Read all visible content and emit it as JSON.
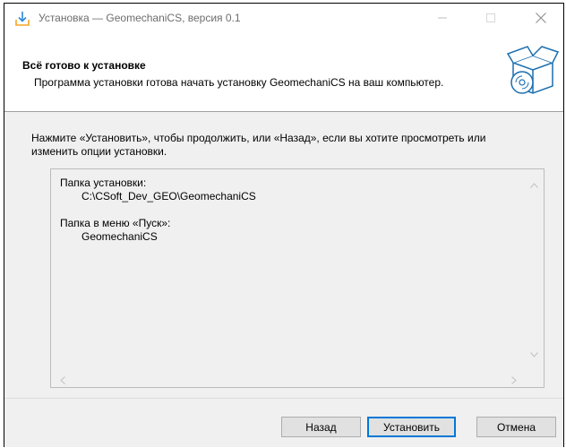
{
  "window": {
    "title": "Установка — GeomechaniCS, версия 0.1"
  },
  "header": {
    "title": "Всё готово к установке",
    "subtitle": "Программа установки готова начать установку GeomechaniCS на ваш компьютер."
  },
  "instruction": "Нажмите «Установить», чтобы продолжить, или «Назад», если вы хотите просмотреть или изменить опции установки.",
  "memo": {
    "install_folder_label": "Папка установки:",
    "install_folder_value": "C:\\CSoft_Dev_GEO\\GeomechaniCS",
    "start_menu_label": "Папка в меню «Пуск»:",
    "start_menu_value": "GeomechaniCS"
  },
  "buttons": {
    "back": "Назад",
    "install": "Установить",
    "cancel": "Отмена"
  },
  "icons": {
    "title": "download-arrow-icon",
    "header": "software-box-cd-icon",
    "minimize": "minimize-icon",
    "maximize": "maximize-icon",
    "close": "close-icon"
  },
  "colors": {
    "accent": "#0078d7",
    "header_bg": "#ffffff",
    "dialog_bg": "#f0f0f0"
  }
}
